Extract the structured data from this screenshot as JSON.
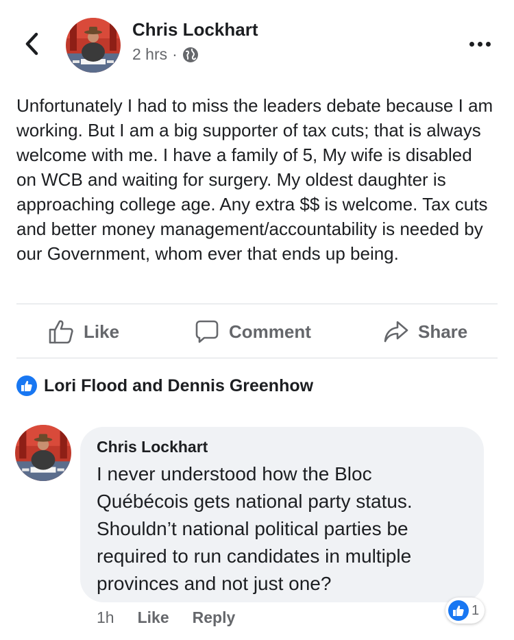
{
  "header": {
    "author": "Chris Lockhart",
    "time": "2 hrs",
    "separator": "·",
    "audience_icon": "globe-icon",
    "more_icon": "more-horizontal-icon",
    "back_icon": "chevron-left-icon"
  },
  "post": {
    "text": "Unfortunately I had to miss the leaders debate because I am working. But I am a big supporter of tax cuts; that is always welcome with me. I have a family of 5, My wife is disabled on WCB and waiting for surgery. My oldest daughter is approaching college age. Any extra $$ is welcome. Tax cuts and better money management/accountability is needed by our Government, whom ever that ends up being."
  },
  "actions": {
    "like": "Like",
    "comment": "Comment",
    "share": "Share"
  },
  "reactions": {
    "icon": "like-icon",
    "text": "Lori Flood and Dennis Greenhow"
  },
  "comment": {
    "author": "Chris Lockhart",
    "text": "I never understood how the Bloc Québécois gets national party status. Shouldn’t national political parties be required to run candidates in multiple provinces and not just one?",
    "time": "1h",
    "like": "Like",
    "reply": "Reply",
    "reaction_count": "1"
  },
  "colors": {
    "accent": "#1877f2",
    "text_primary": "#1c1e21",
    "text_secondary": "#65676b",
    "bubble": "#f0f2f5",
    "divider": "#dadde1"
  }
}
